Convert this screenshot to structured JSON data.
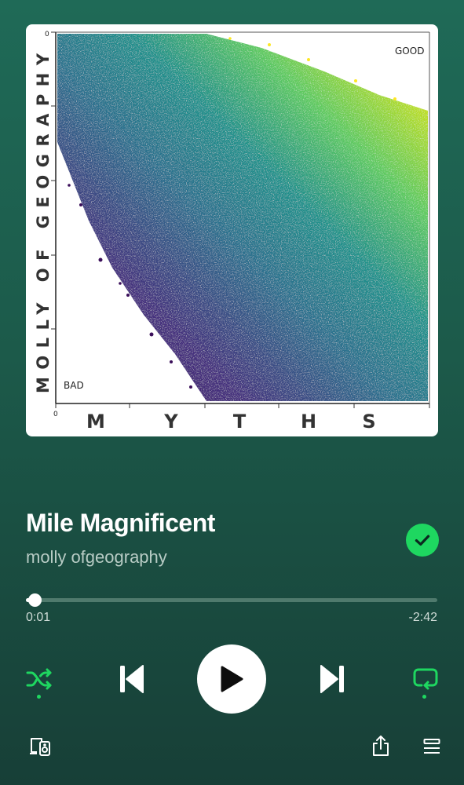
{
  "album_art": {
    "y_axis_title": "MOLLY OF GEOGRAPHY",
    "x_axis_letters": [
      "M",
      "Y",
      "T",
      "H",
      "S"
    ],
    "corner_good": "GOOD",
    "corner_bad": "BAD",
    "axis_zero_x": "0",
    "axis_zero_y": "0"
  },
  "track": {
    "title": "Mile Magnificent",
    "artist": "molly ofgeography",
    "liked": true
  },
  "progress": {
    "elapsed": "0:01",
    "remaining": "-2:42",
    "fraction": 0.006
  },
  "controls": {
    "shuffle_active": true,
    "repeat_active": true,
    "state": "paused"
  },
  "colors": {
    "accent": "#1ed760",
    "background_top": "#1f6a57",
    "background_bottom": "#173f37"
  },
  "icons": [
    "shuffle-icon",
    "previous-icon",
    "play-icon",
    "next-icon",
    "repeat-icon",
    "connect-device-icon",
    "share-icon",
    "queue-icon"
  ]
}
